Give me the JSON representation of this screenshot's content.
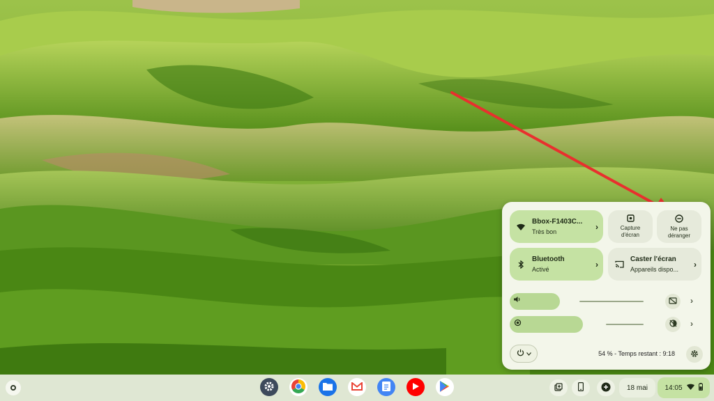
{
  "wifi_tile": {
    "title": "Bbox-F1403C...",
    "subtitle": "Très bon",
    "icon": "wifi-icon"
  },
  "bluetooth_tile": {
    "title": "Bluetooth",
    "subtitle": "Activé",
    "icon": "bluetooth-icon"
  },
  "screen_capture": {
    "label_line1": "Capture",
    "label_line2": "d'écran",
    "icon": "screen-capture-icon"
  },
  "do_not_disturb": {
    "label_line1": "Ne pas",
    "label_line2": "déranger",
    "icon": "do-not-disturb-icon"
  },
  "cast_tile": {
    "title": "Caster l'écran",
    "subtitle": "Appareils dispo...",
    "icon": "cast-icon"
  },
  "volume": {
    "level": 0.37,
    "icon": "volume-icon",
    "side_icon": "live-caption-off-icon"
  },
  "brightness": {
    "level": 0.54,
    "icon": "brightness-icon",
    "side_icon": "night-light-off-icon"
  },
  "battery_status": "54 % - Temps restant : 9:18",
  "shelf": {
    "apps": [
      {
        "name": "settings-app",
        "icon": "gear-icon"
      },
      {
        "name": "chrome-app",
        "icon": "chrome-icon"
      },
      {
        "name": "files-app",
        "icon": "folder-icon"
      },
      {
        "name": "gmail-app",
        "icon": "gmail-icon"
      },
      {
        "name": "docs-app",
        "icon": "docs-icon"
      },
      {
        "name": "youtube-app",
        "icon": "youtube-icon"
      },
      {
        "name": "play-store-app",
        "icon": "play-store-icon"
      }
    ],
    "date": "18 mai",
    "time": "14:05"
  },
  "colors": {
    "accent_tile": "#c5e2a3",
    "panel_background": "#f3f6ea",
    "shelf_background": "#dfe7d3",
    "arrow": "#e8302e"
  }
}
